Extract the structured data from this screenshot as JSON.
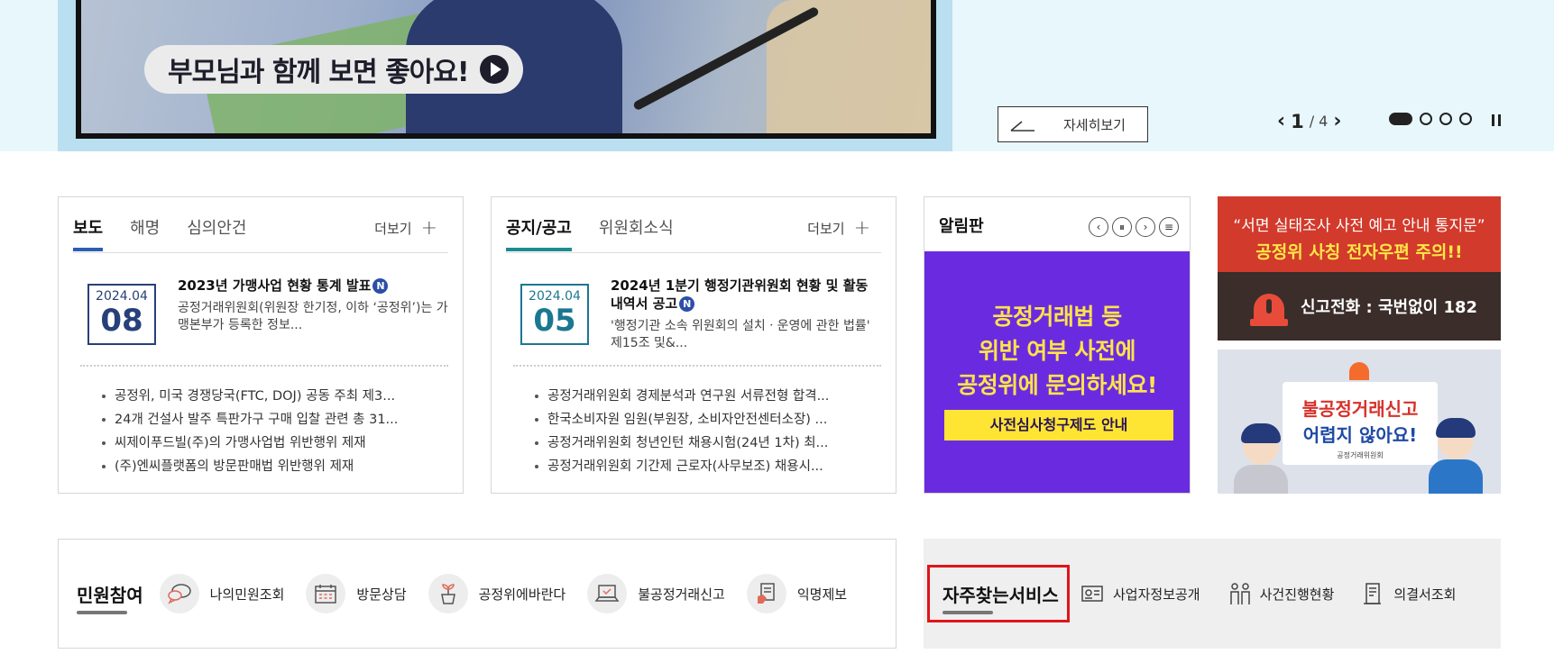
{
  "banner": {
    "caption": "부모님과 함께 보면 좋아요!",
    "detail_label": "자세히보기",
    "slide_current": "1",
    "slide_sep_total": "/ 4",
    "dots_total": 4,
    "dot_active_index": 0
  },
  "press_panel": {
    "tabs": [
      "보도",
      "해명",
      "심의안건"
    ],
    "active_tab": 0,
    "more_label": "더보기",
    "featured": {
      "date_ym": "2024.04",
      "date_d": "08",
      "headline": "2023년 가맹사업 현황 통계 발표",
      "badge": "N",
      "summary": "공정거래위원회(위원장 한기정, 이하 ‘공정위’)는 가맹본부가 등록한 정보..."
    },
    "items": [
      "공정위, 미국 경쟁당국(FTC, DOJ) 공동 주최 제3...",
      "24개 건설사 발주 특판가구 구매 입찰 관련 총 31...",
      "씨제이푸드빌(주)의 가맹사업법 위반행위 제재",
      "(주)엔씨플랫폼의 방문판매법 위반행위 제재"
    ]
  },
  "notice_panel": {
    "tabs": [
      "공지/공고",
      "위원회소식"
    ],
    "active_tab": 0,
    "more_label": "더보기",
    "featured": {
      "date_ym": "2024.04",
      "date_d": "05",
      "headline": "2024년 1분기 행정기관위원회 현황 및 활동 내역서 공고",
      "badge": "N",
      "summary": "'행정기관 소속 위원회의 설치ㆍ운영에 관한 법률' 제15조 및&..."
    },
    "items": [
      "공정거래위원회 경제분석과 연구원 서류전형 합격...",
      "한국소비자원 임원(부원장, 소비자안전센터소장) ...",
      "공정거래위원회 청년인턴 채용시험(24년 1차) 최...",
      "공정거래위원회 기간제 근로자(사무보조) 채용시..."
    ]
  },
  "board": {
    "title": "알림판",
    "banner_line1": "공정거래법 등",
    "banner_line2": "위반 여부 사전에",
    "banner_line3": "공정위에 문의하세요!",
    "banner_cta": "사전심사청구제도 안내"
  },
  "ad_scam": {
    "line1": "“서면 실태조사 사전 예고 안내 통지문”",
    "line2": "공정위 사칭 전자우편 주의!!",
    "phone": "신고전화 : 국번없이 182"
  },
  "ad_report": {
    "line1": "불공정거래신고",
    "line2": "어렵지 않아요!",
    "logo": "공정거래위원회"
  },
  "civil": {
    "title": "민원참여",
    "items": [
      {
        "label": "나의민원조회",
        "icon": "speech-bubble-icon"
      },
      {
        "label": "방문상담",
        "icon": "calendar-icon"
      },
      {
        "label": "공정위에바란다",
        "icon": "sprout-icon"
      },
      {
        "label": "불공정거래신고",
        "icon": "laptop-icon"
      },
      {
        "label": "익명제보",
        "icon": "document-hand-icon"
      }
    ]
  },
  "favorites": {
    "title": "자주찾는서비스",
    "items": [
      {
        "label": "사업자정보공개",
        "icon": "id-card-icon"
      },
      {
        "label": "사건진행현황",
        "icon": "people-icon"
      },
      {
        "label": "의결서조회",
        "icon": "document-icon"
      }
    ]
  },
  "colors": {
    "press_accent": "#2a5fb1",
    "notice_accent": "#1e8b8f",
    "board_banner": "#6a2be0",
    "highlight_border": "#e0151b"
  }
}
